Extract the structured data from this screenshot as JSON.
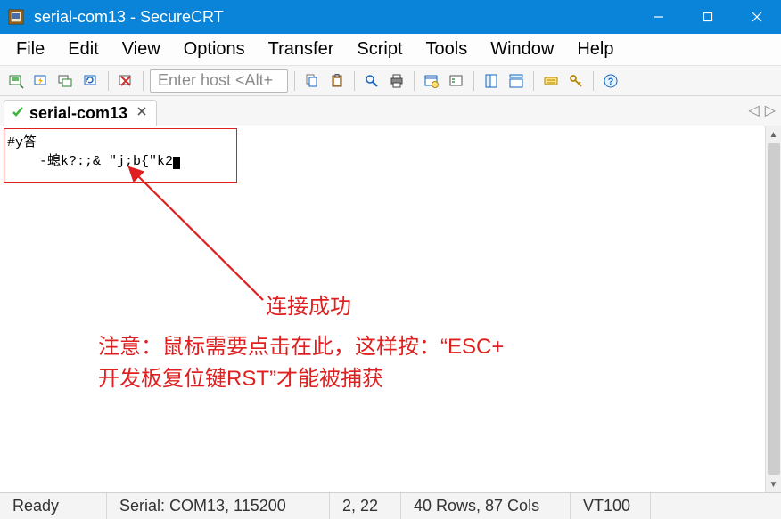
{
  "window": {
    "title": "serial-com13 - SecureCRT"
  },
  "menu": {
    "items": [
      "File",
      "Edit",
      "View",
      "Options",
      "Transfer",
      "Script",
      "Tools",
      "Window",
      "Help"
    ]
  },
  "toolbar": {
    "host_placeholder": "Enter host <Alt+"
  },
  "tab": {
    "label": "serial-com13"
  },
  "terminal": {
    "line1": "#y答",
    "line2": "    -螅k?:;& \"j;b{\"k2"
  },
  "annotation": {
    "label_success": "连接成功",
    "note_line1": "注意：鼠标需要点击在此，这样按：“ESC+",
    "note_line2": "开发板复位键RST”才能被捕获"
  },
  "status": {
    "ready": "Ready",
    "conn": "Serial: COM13, 115200",
    "pos": "2,  22",
    "size": "40 Rows, 87 Cols",
    "term": "VT100"
  }
}
